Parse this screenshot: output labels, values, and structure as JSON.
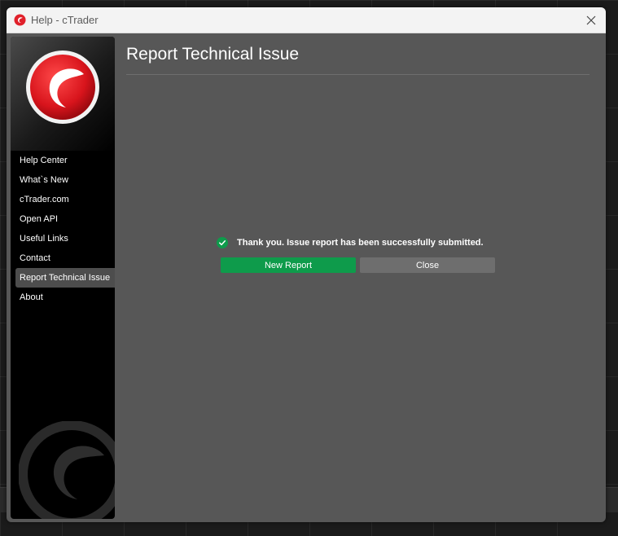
{
  "window": {
    "title": "Help - cTrader"
  },
  "sidebar": {
    "items": [
      {
        "label": "Help Center"
      },
      {
        "label": "What`s New"
      },
      {
        "label": "cTrader.com"
      },
      {
        "label": "Open API"
      },
      {
        "label": "Useful Links"
      },
      {
        "label": "Contact"
      },
      {
        "label": "Report Technical Issue",
        "active": true
      },
      {
        "label": "About"
      }
    ]
  },
  "main": {
    "title": "Report Technical Issue",
    "status_message": "Thank you. Issue report has been successfully submitted.",
    "new_report_label": "New Report",
    "close_label": "Close"
  },
  "colors": {
    "brand_red": "#e0202a",
    "success_green": "#0e9b4b",
    "dialog_bg": "#575757",
    "sidebar_bg": "#000000"
  },
  "icons": {
    "title": "ctrader-logo-icon",
    "close": "close-icon",
    "logo": "ctrader-logo",
    "status": "check-circle-icon",
    "watermark": "ctrader-watermark-icon"
  }
}
